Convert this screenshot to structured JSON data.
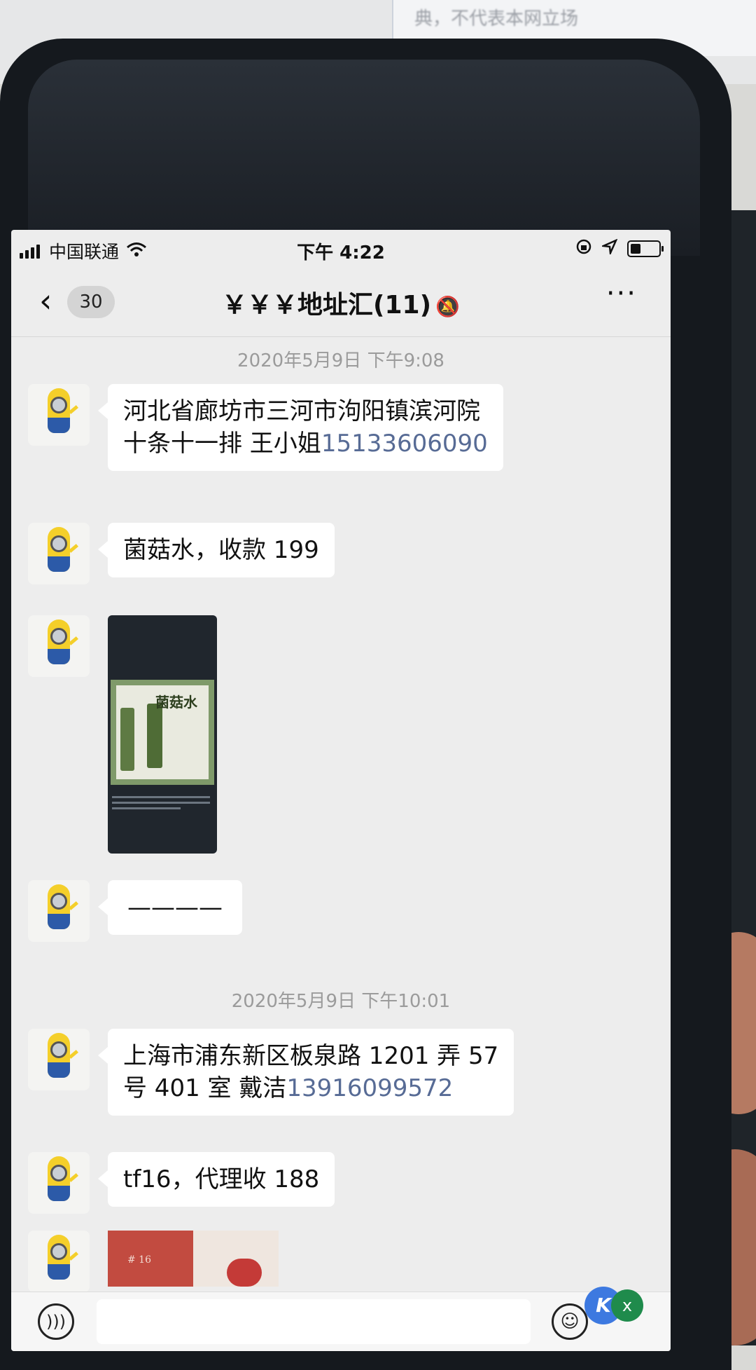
{
  "background": {
    "doc_text": "典，不代表本网立场"
  },
  "status_bar": {
    "carrier": "中国联通",
    "time": "下午 4:22"
  },
  "nav": {
    "back_count": "30",
    "title": "￥￥￥地址汇(11)",
    "more": "···"
  },
  "messages": {
    "timestamp_1": "2020年5月9日 下午9:08",
    "m1_line1": "河北省廊坊市三河市泃阳镇滨河院",
    "m1_line2_text": "十条十一排   王小姐",
    "m1_phone": "15133606090",
    "m2": "菌菇水，收款 199",
    "m3_image_text": "菌菇水",
    "m4": "————",
    "timestamp_2": "2020年5月9日 下午10:01",
    "m5_line1": "上海市浦东新区板泉路 1201 弄 57",
    "m5_line2_text": "号 401 室 戴洁",
    "m5_phone": "13916099572",
    "m6": "tf16，代理收 188",
    "m7_label": "# 16"
  },
  "input_bar": {
    "placeholder": ""
  },
  "colors": {
    "link": "#576b95",
    "bubble": "#ffffff",
    "chat_bg": "#ededed"
  }
}
